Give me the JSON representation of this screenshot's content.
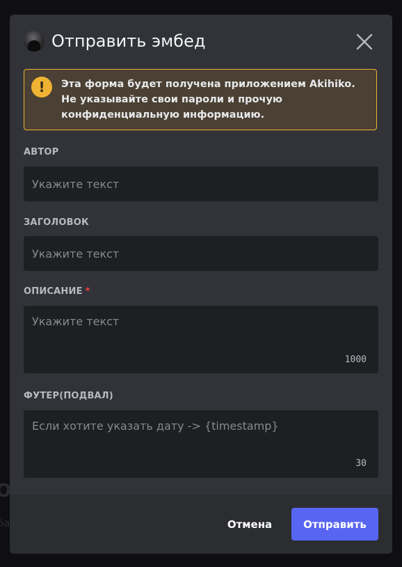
{
  "background": {
    "text1": "О",
    "text2": "ба"
  },
  "modal": {
    "title": "Отправить эмбед",
    "close_icon": "close-icon",
    "avatar_icon": "avatar"
  },
  "warning": {
    "icon": "!",
    "text_before": "Эта форма будет получена приложением ",
    "app_name": "Akihiko",
    "text_after": ". Не указывайте свои пароли и прочую конфиденциальную информацию.",
    "border_color": "#f0b232"
  },
  "fields": {
    "author": {
      "label": "АВТОР",
      "placeholder": "Укажите текст",
      "value": ""
    },
    "title": {
      "label": "ЗАГОЛОВОК",
      "placeholder": "Укажите текст",
      "value": ""
    },
    "description": {
      "label": "ОПИСАНИЕ",
      "required_mark": "*",
      "placeholder": "Укажите текст",
      "value": "",
      "counter": "1000"
    },
    "footer": {
      "label": "ФУТЕР(ПОДВАЛ)",
      "placeholder": "Если хотите указать дату -> {timestamp}",
      "value": "",
      "counter": "30"
    }
  },
  "actions": {
    "cancel_label": "Отмена",
    "submit_label": "Отправить",
    "submit_color": "#5865f2"
  }
}
